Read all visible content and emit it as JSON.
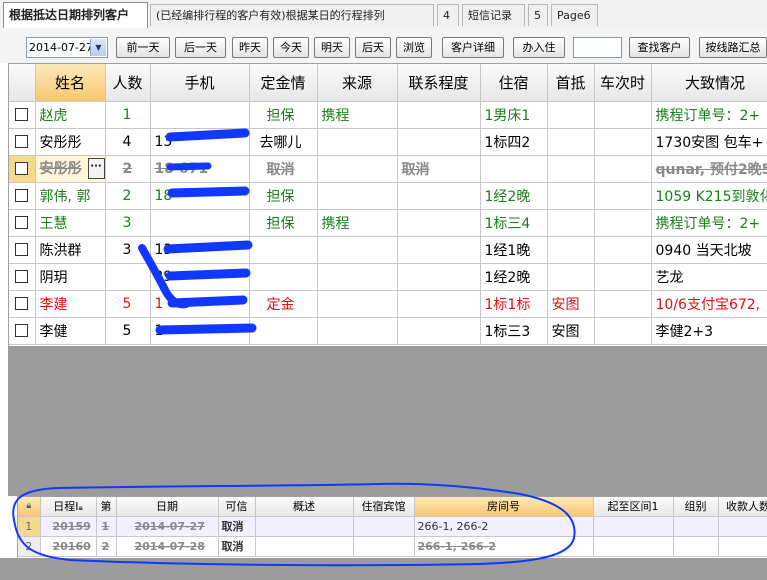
{
  "tabs": [
    {
      "label": "根据抵达日期排列客户"
    },
    {
      "label": "(已经编排行程的客户有效)根据某日的行程排列"
    },
    {
      "label": "4"
    },
    {
      "label": "短信记录"
    },
    {
      "label": "5"
    },
    {
      "label": "Page6"
    }
  ],
  "toolbar": {
    "date": "2014-07-27",
    "buttons": [
      "前一天",
      "后一天",
      "昨天",
      "今天",
      "明天",
      "后天",
      "浏览",
      "客户详细",
      "办入住",
      "查找客户",
      "按线路汇总"
    ]
  },
  "grid1": {
    "columns": [
      "姓名",
      "人数",
      "手机",
      "定金情",
      "来源",
      "联系程度",
      "住宿",
      "首抵",
      "车次时",
      "大致情况"
    ],
    "rows": [
      {
        "style": "green",
        "name": "赵虎",
        "count": "1",
        "phone": "",
        "deposit": "担保",
        "source": "携程",
        "contact": "",
        "lodging": "1男床1",
        "first": "",
        "train": "",
        "summary": "携程订单号：2+"
      },
      {
        "style": "normal",
        "name": "安彤彤",
        "count": "4",
        "phone": "13",
        "deposit": "去哪儿",
        "source": "",
        "contact": "",
        "lodging": "1标四2",
        "first": "",
        "train": "",
        "summary": "1730安图 包车+"
      },
      {
        "style": "struck",
        "name": "安彤彤",
        "count": "2",
        "phone": "18       671",
        "deposit": "取消",
        "source": "",
        "contact": "取消",
        "lodging": "",
        "first": "",
        "train": "",
        "summary": "qunar, 预付2晚55元"
      },
      {
        "style": "green",
        "name": "郭伟, 郭",
        "count": "2",
        "phone": "18",
        "deposit": "担保",
        "source": "",
        "contact": "",
        "lodging": "1经2晚",
        "first": "",
        "train": "",
        "summary": "1059 K215到敦化"
      },
      {
        "style": "green",
        "name": "王慧",
        "count": "3",
        "phone": "",
        "deposit": "担保",
        "source": "携程",
        "contact": "",
        "lodging": "1标三4",
        "first": "",
        "train": "",
        "summary": "携程订单号：2+"
      },
      {
        "style": "normal",
        "name": "陈洪群",
        "count": "3",
        "phone": "13",
        "deposit": "",
        "source": "",
        "contact": "",
        "lodging": "1经1晚",
        "first": "",
        "train": "",
        "summary": "0940 当天北坡"
      },
      {
        "style": "normal",
        "name": "阴玥",
        "count": "",
        "phone": "           39",
        "deposit": "",
        "source": "",
        "contact": "",
        "lodging": "1经2晚",
        "first": "",
        "train": "",
        "summary": "艺龙"
      },
      {
        "style": "red",
        "name": "李建",
        "count": "5",
        "phone": "1",
        "deposit": "定金",
        "source": "",
        "contact": "",
        "lodging": "1标1标",
        "first": "安图",
        "train": "",
        "summary": "10/6支付宝672,"
      },
      {
        "style": "normal",
        "name": "李健",
        "count": "5",
        "phone": "1",
        "deposit": "",
        "source": "",
        "contact": "",
        "lodging": "1标三3",
        "first": "安图",
        "train": "",
        "summary": "李健2+3"
      }
    ]
  },
  "grid2": {
    "columns": [
      "",
      "日程I",
      "第",
      "日期",
      "可信",
      "概述",
      "住宿宾馆",
      "房间号",
      "起至区间1",
      "组别",
      "收款人数"
    ],
    "rows": [
      {
        "num": "1",
        "id": "20159",
        "seq": "1",
        "date": "2014-07-27",
        "credible": "取消",
        "summary": "",
        "hotel": "",
        "room": "266-1, 266-2",
        "range": "",
        "group": "",
        "payers": ""
      },
      {
        "num": "2",
        "id": "20160",
        "seq": "2",
        "date": "2014-07-28",
        "credible": "取消",
        "summary": "",
        "hotel": "",
        "room": "266-1, 266-2",
        "range": "",
        "group": "",
        "payers": ""
      }
    ]
  },
  "colors": {
    "green_text": "#1a7f1a",
    "red_text": "#e01010",
    "struck_text": "#8a8a8a",
    "sorted_header": "#f8c770",
    "annotation_blue": "#1038ff",
    "empty_area": "#9c9c9c"
  },
  "icons": [
    "checkbox-icon",
    "ellipsis-button-icon",
    "dropdown-arrow-icon",
    "lock-icon"
  ]
}
